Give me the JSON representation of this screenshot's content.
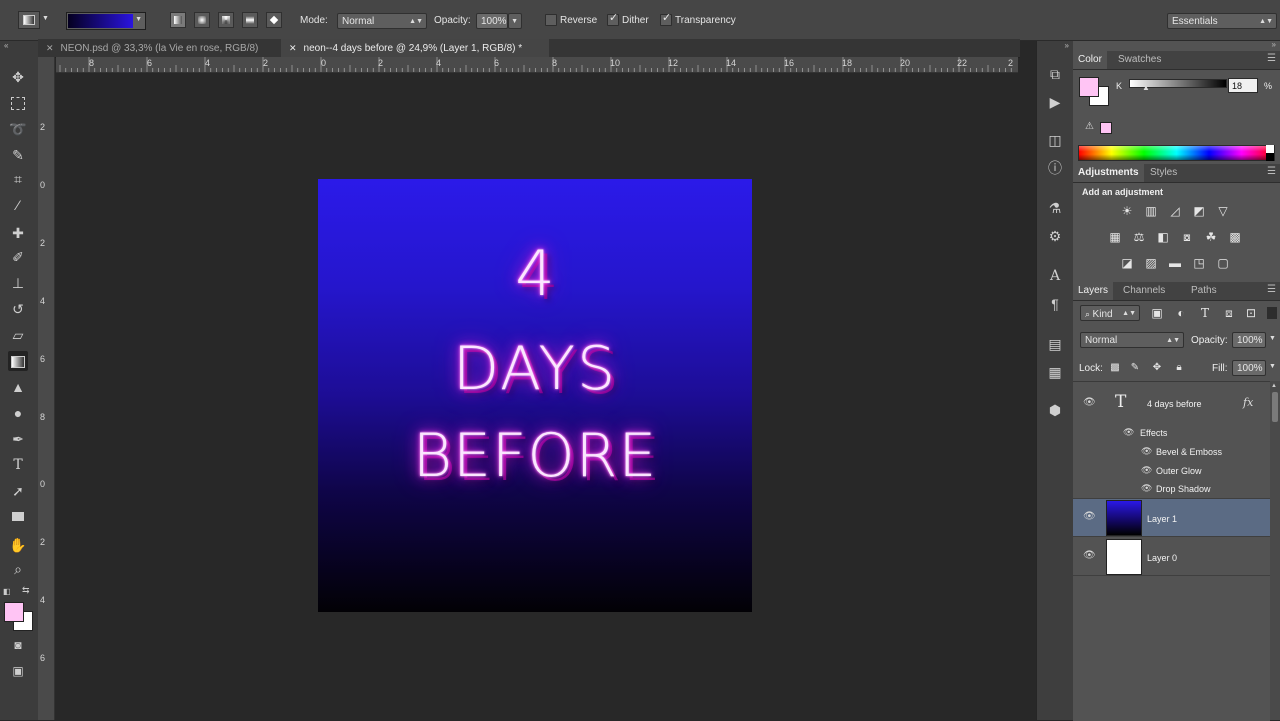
{
  "options_bar": {
    "mode_label": "Mode:",
    "mode_value": "Normal",
    "opacity_label": "Opacity:",
    "opacity_value": "100%",
    "reverse_label": "Reverse",
    "dither_label": "Dither",
    "transparency_label": "Transparency",
    "reverse_checked": false,
    "dither_checked": true,
    "transparency_checked": true,
    "workspace": "Essentials",
    "gradient_colors": [
      "#050020",
      "#2a14e0"
    ]
  },
  "tabs": [
    {
      "title": "NEON.psd @ 33,3% (la Vie en rose, RGB/8)",
      "active": false
    },
    {
      "title": "neon--4 days before @ 24,9% (Layer 1, RGB/8) *",
      "active": true
    }
  ],
  "rulers": {
    "horizontal": [
      "8",
      "6",
      "4",
      "2",
      "0",
      "2",
      "4",
      "6",
      "8",
      "10",
      "12",
      "14",
      "16",
      "18",
      "20",
      "22",
      "2"
    ],
    "vertical": [
      "2",
      "0",
      "2",
      "4",
      "6",
      "8",
      "0",
      "2",
      "4",
      "6"
    ]
  },
  "artwork": {
    "line1": "4",
    "line2": "DAYS",
    "line3": "BEFORE"
  },
  "color_panel": {
    "tabs": [
      "Color",
      "Swatches"
    ],
    "channel_label": "K",
    "channel_value": "18",
    "unit": "%",
    "foreground": "#ffc4f4",
    "background": "#ffffff"
  },
  "adjustments_panel": {
    "tabs": [
      "Adjustments",
      "Styles"
    ],
    "heading": "Add an adjustment"
  },
  "layers_panel": {
    "tabs": [
      "Layers",
      "Channels",
      "Paths"
    ],
    "filter_label": "Kind",
    "blend_mode": "Normal",
    "opacity_label": "Opacity:",
    "opacity_value": "100%",
    "lock_label": "Lock:",
    "fill_label": "Fill:",
    "fill_value": "100%",
    "text_layer": "4  days before",
    "effects_label": "Effects",
    "effects": [
      "Bevel & Emboss",
      "Outer Glow",
      "Drop Shadow"
    ],
    "layer1": "Layer 1",
    "layer0": "Layer 0",
    "fx_label": "fx"
  },
  "toolbox": {
    "foreground": "#ffc4f4",
    "background": "#ffffff"
  }
}
